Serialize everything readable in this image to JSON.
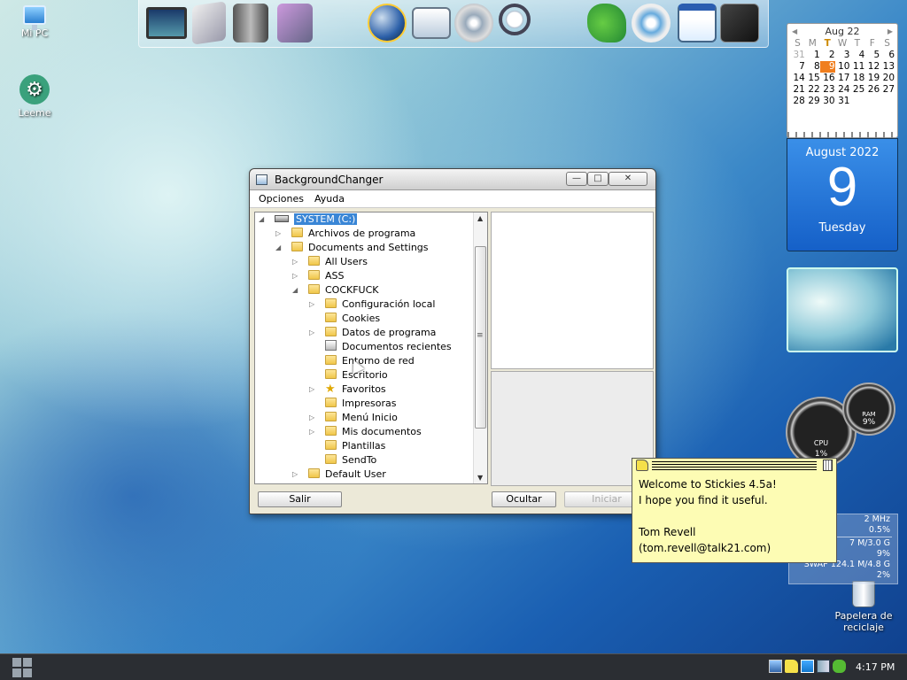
{
  "desktop": {
    "icons": [
      {
        "label": "Mi PC",
        "icon": "computer-icon"
      },
      {
        "label": "Leeme",
        "icon": "gear-icon"
      },
      {
        "label": "Papelera de reciclaje",
        "icon": "recycle-bin-icon"
      }
    ]
  },
  "dock": {
    "items": [
      "monitor-icon",
      "documents-icon",
      "books-icon",
      "flower-icon",
      "globe-icon",
      "mail-icon",
      "music-icon",
      "search-icon",
      "gator-icon",
      "settings-icon",
      "calendar-icon",
      "box-icon"
    ]
  },
  "calendar": {
    "month_label": "Aug 22",
    "prev": "◀",
    "next": "▶",
    "weekdays": [
      "S",
      "M",
      "T",
      "W",
      "T",
      "F",
      "S"
    ],
    "weeks": [
      [
        "31",
        "1",
        "2",
        "3",
        "4",
        "5",
        "6"
      ],
      [
        "7",
        "8",
        "9",
        "10",
        "11",
        "12",
        "13"
      ],
      [
        "14",
        "15",
        "16",
        "17",
        "18",
        "19",
        "20"
      ],
      [
        "21",
        "22",
        "23",
        "24",
        "25",
        "26",
        "27"
      ],
      [
        "28",
        "29",
        "30",
        "31",
        "",
        "",
        ""
      ]
    ],
    "selected_day": "9",
    "day_card": {
      "month_year": "August 2022",
      "day": "9",
      "weekday": "Tuesday"
    },
    "accent_color": "#f07e1e"
  },
  "gauges": {
    "cpu": {
      "label": "CPU",
      "value": "1%"
    },
    "ram": {
      "label": "RAM",
      "value": "9%"
    }
  },
  "sysmon": {
    "lines": [
      "2 MHz",
      "0.5%",
      "7 M/3.0 G",
      "9%",
      "SWAP  124.1 M/4.8 G",
      "2%"
    ]
  },
  "window": {
    "title": "BackgroundChanger",
    "controls": {
      "minimize": "—",
      "maximize": "□",
      "close": "✕"
    },
    "menu": [
      "Opciones",
      "Ayuda"
    ],
    "tree": [
      {
        "label": "SYSTEM (C:)",
        "level": 0,
        "type": "drive",
        "expander": "◢",
        "selected": true
      },
      {
        "label": "Archivos de programa",
        "level": 1,
        "type": "folder",
        "expander": "▷"
      },
      {
        "label": "Documents and Settings",
        "level": 1,
        "type": "folder",
        "expander": "◢"
      },
      {
        "label": "All Users",
        "level": 2,
        "type": "folder",
        "expander": "▷"
      },
      {
        "label": "ASS",
        "level": 2,
        "type": "folder",
        "expander": "▷"
      },
      {
        "label": "COCKFUCK",
        "level": 2,
        "type": "folder",
        "expander": "◢"
      },
      {
        "label": "Configuración local",
        "level": 3,
        "type": "folder",
        "expander": "▷"
      },
      {
        "label": "Cookies",
        "level": 3,
        "type": "folder",
        "expander": ""
      },
      {
        "label": "Datos de programa",
        "level": 3,
        "type": "folder",
        "expander": "▷"
      },
      {
        "label": "Documentos recientes",
        "level": 3,
        "type": "recent",
        "expander": ""
      },
      {
        "label": "Entorno de red",
        "level": 3,
        "type": "folder",
        "expander": ""
      },
      {
        "label": "Escritorio",
        "level": 3,
        "type": "folder",
        "expander": ""
      },
      {
        "label": "Favoritos",
        "level": 3,
        "type": "star",
        "expander": "▷"
      },
      {
        "label": "Impresoras",
        "level": 3,
        "type": "folder",
        "expander": ""
      },
      {
        "label": "Menú Inicio",
        "level": 3,
        "type": "folder",
        "expander": "▷"
      },
      {
        "label": "Mis documentos",
        "level": 3,
        "type": "folder",
        "expander": "▷"
      },
      {
        "label": "Plantillas",
        "level": 3,
        "type": "folder",
        "expander": ""
      },
      {
        "label": "SendTo",
        "level": 3,
        "type": "folder",
        "expander": ""
      },
      {
        "label": "Default User",
        "level": 2,
        "type": "folder",
        "expander": "▷"
      }
    ],
    "buttons": {
      "exit": "Salir",
      "hide": "Ocultar",
      "start": "Iniciar"
    }
  },
  "stickies": {
    "lines": [
      "Welcome to Stickies 4.5a!",
      "I hope you find it useful.",
      "",
      "Tom Revell",
      "(tom.revell@talk21.com)"
    ],
    "note_color": "#fdfcb4"
  },
  "taskbar": {
    "tray_icons": [
      "display-icon",
      "sticky-icon",
      "window-icon",
      "network-icon",
      "gator-tray-icon"
    ],
    "clock": "4:17 PM"
  }
}
